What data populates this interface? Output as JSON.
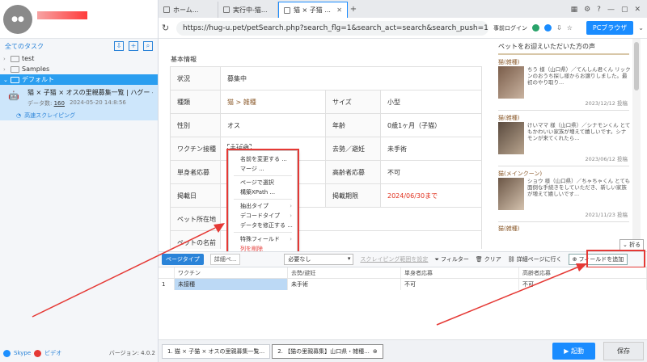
{
  "left": {
    "task_header": "全てのタスク",
    "tree": [
      {
        "label": "test"
      },
      {
        "label": "Samples"
      },
      {
        "label": "デフォルト"
      }
    ],
    "task": {
      "name": "猫 × 子猫 × オスの里親募集一覧 | ハグー -...",
      "count_label": "データ数:",
      "count": "160",
      "date": "2024-05-20 14:8:56",
      "mode": "高速スクレイピング"
    },
    "footer": {
      "skype": "Skype",
      "video": "ビデオ",
      "version": "バージョン: 4.0.2"
    }
  },
  "browser": {
    "tabs": [
      {
        "label": "ホーム..."
      },
      {
        "label": "実行中-猫..."
      },
      {
        "label": "猫 × 子猫 ..."
      }
    ],
    "url": "https://hug-u.pet/petSearch.php?search_flg=1&search_act=search&search_push=1&pref_m...",
    "login_label": "事前ログイン",
    "pc_browser": "PCブラウザ"
  },
  "page": {
    "section_title": "基本情報",
    "rows": [
      {
        "k": "状況",
        "v": "募集中",
        "k2": "",
        "v2": ""
      },
      {
        "k": "種類",
        "v": "猫 > 雑種",
        "k2": "サイズ",
        "v2": "小型"
      },
      {
        "k": "性別",
        "v": "オス",
        "k2": "年齢",
        "v2": "0歳1ヶ月（子猫）"
      },
      {
        "k": "ワクチン接種",
        "v": "未接種",
        "k2": "去勢／避妊",
        "v2": "未手術"
      },
      {
        "k": "単身者応募",
        "v": "",
        "k2": "高齢者応募",
        "v2": "不可"
      },
      {
        "k": "掲載日",
        "v": "",
        "k2": "掲載期限",
        "v2": "2024/06/30まで"
      },
      {
        "k": "ペット所在地",
        "v": "",
        "k2": "",
        "v2": ""
      },
      {
        "k": "ペットの名前",
        "v": "",
        "k2": "",
        "v2": ""
      }
    ]
  },
  "reviews": {
    "title": "ペットをお迎えいただいた方の声",
    "items": [
      {
        "tag": "猫(雑種)",
        "text": "ちう 様（山口県）／てんしん君くん リックンのおうち探し様からお譲りしました。最初のやり取り...",
        "date": "2023/12/12 投稿"
      },
      {
        "tag": "猫(雑種)",
        "text": "けいママ 様（山口県）／シナモンくん とてもかわいい家族が増えて嬉しいです。シナモンが来てくれたら...",
        "date": "2023/06/12 投稿"
      },
      {
        "tag": "猫(メインクーン)",
        "text": "ショウ 様（山口県）／ちゃちゃくん とても面倒な手続きをしていただき、新しい家族が増えて嬉しいです...",
        "date": "2021/11/23 投稿"
      }
    ],
    "next_tag": "猫(雑種)",
    "fold": "折る"
  },
  "context_menu": {
    "items": [
      "名前を変更する ...",
      "マージ ...",
      "ページで選択",
      "構築XPath ...",
      "抽出タイプ",
      "デコードタイプ",
      "データを修正する ...",
      "特殊フィールド",
      "列を削除"
    ]
  },
  "data_panel": {
    "page_type": "ページタイプ",
    "detail_page": "詳細ペ...",
    "select_value": "必要なし",
    "scrape_link": "スクレイピング範囲を設定",
    "filter": "フィルター",
    "clear": "クリア",
    "go_detail": "詳細ページに行く",
    "add_field": "フィールドを追加",
    "columns": [
      "",
      "ワクチン",
      "去勢/避妊",
      "単身者応募",
      "高齢者応募"
    ],
    "rows": [
      [
        "1",
        "未接種",
        "未手術",
        "不可",
        "不可"
      ]
    ]
  },
  "taskbar": {
    "tabs": [
      {
        "label": "1. 猫 × 子猫 × オスの里親募集一覧..."
      },
      {
        "label": "2. 【猫の里親募集】山口県・雑種..."
      }
    ],
    "start": "起動",
    "save": "保存"
  },
  "colors": {
    "accent": "#1a8cff",
    "highlight": "#e53935",
    "selected_row": "#2a9ef0"
  }
}
